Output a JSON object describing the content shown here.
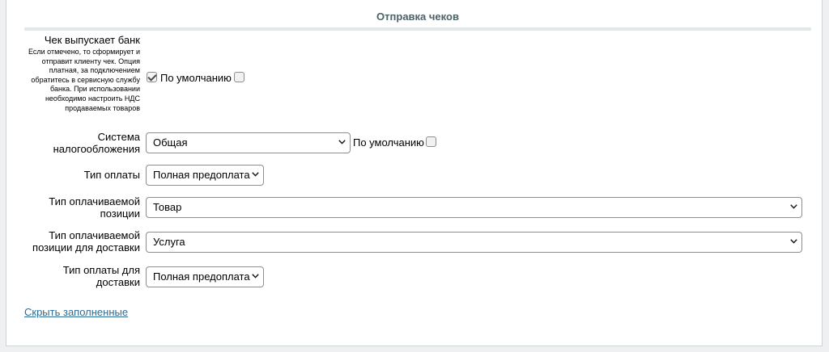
{
  "section": {
    "title": "Отправка чеков"
  },
  "bank_receipt": {
    "label": "Чек выпускает банк",
    "hint": "Если отмечено, то сформирует и отправит клиенту чек. Опция платная, за подключением обратитесь в сервисную службу банка. При использовании необходимо настроить НДС продаваемых товаров",
    "checked": true,
    "default_label": "По умолчанию",
    "default_checked": false
  },
  "tax_system": {
    "label": "Система налогообложения",
    "value": "Общая",
    "default_label": "По умолчанию",
    "default_checked": false
  },
  "payment_type": {
    "label": "Тип оплаты",
    "value": "Полная предоплата"
  },
  "item_type": {
    "label": "Тип оплачиваемой позиции",
    "value": "Товар"
  },
  "delivery_item_type": {
    "label": "Тип оплачиваемой позиции для доставки",
    "value": "Услуга"
  },
  "delivery_payment_type": {
    "label": "Тип оплаты для доставки",
    "value": "Полная предоплата"
  },
  "footer": {
    "hide_filled_link": "Скрыть заполненные"
  }
}
